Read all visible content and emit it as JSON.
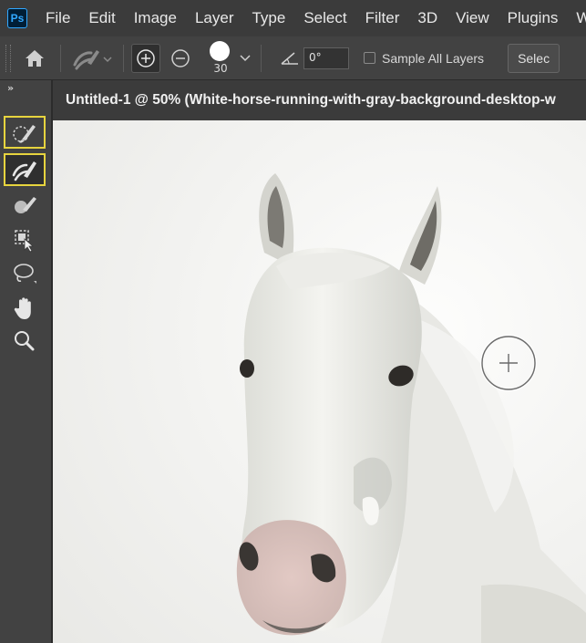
{
  "menubar": {
    "logo": "Ps",
    "items": [
      "File",
      "Edit",
      "Image",
      "Layer",
      "Type",
      "Select",
      "Filter",
      "3D",
      "View",
      "Plugins",
      "Winc"
    ]
  },
  "options_bar": {
    "brush_size": "30",
    "angle_value": "0°",
    "sample_all_layers_label": "Sample All Layers",
    "sample_all_layers_checked": false,
    "select_subject_label": "Selec"
  },
  "toolbar": {
    "collapse_label": "»",
    "tools": [
      {
        "name": "object-selection-tool",
        "icon": "quick-selection-brush-icon",
        "highlighted": true
      },
      {
        "name": "select-and-mask-brush-tool",
        "icon": "refine-edge-brush-icon",
        "highlighted": true,
        "selected": true
      },
      {
        "name": "brush-tool",
        "icon": "brush-icon"
      },
      {
        "name": "object-selection-tool",
        "icon": "object-selection-icon"
      },
      {
        "name": "lasso-tool",
        "icon": "lasso-icon"
      },
      {
        "name": "hand-tool",
        "icon": "hand-icon"
      },
      {
        "name": "zoom-tool",
        "icon": "zoom-icon"
      }
    ]
  },
  "document": {
    "tab_title": "Untitled-1 @ 50% (White-horse-running-with-gray-background-desktop-w"
  },
  "colors": {
    "accent_highlight": "#e7d43e",
    "menubar_bg": "#3b3b3b",
    "panel_bg": "#424242",
    "canvas_bg": "#f4f4f2"
  }
}
